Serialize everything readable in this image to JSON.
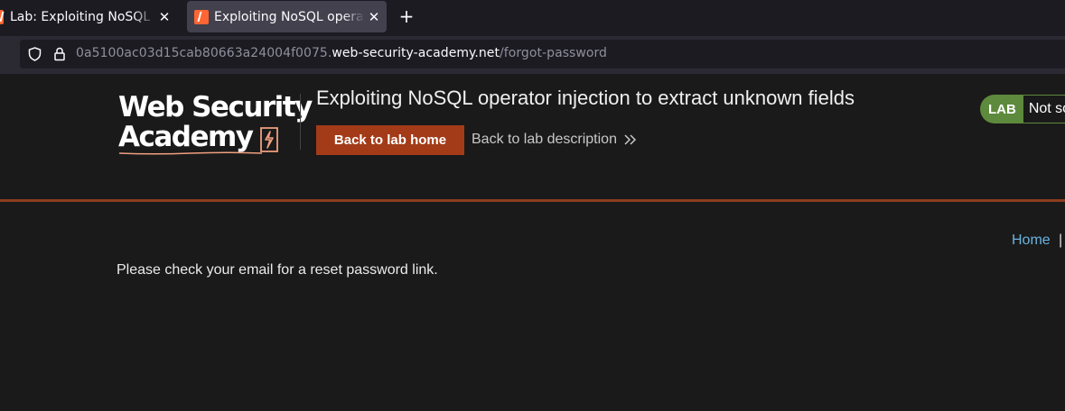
{
  "browser": {
    "tabs": [
      {
        "title": "Lab: Exploiting NoSQL op",
        "active": false
      },
      {
        "title": "Exploiting NoSQL operato",
        "active": true
      }
    ],
    "new_tab_glyph": "+",
    "close_glyph": "✕",
    "url": {
      "prefix": "0a5100ac03d15cab80663a24004f0075.",
      "domain": "web-security-academy.net",
      "path": "/forgot-password"
    }
  },
  "header": {
    "logo": {
      "line1": "Web Security",
      "line2": "Academy"
    },
    "lab_title": "Exploiting NoSQL operator injection to extract unknown fields",
    "back_to_lab_home": "Back to lab home",
    "back_to_lab_description": "Back to lab description",
    "status_badge": "LAB",
    "status_text": "Not solved"
  },
  "nav": {
    "home": "Home",
    "separator": "|"
  },
  "main": {
    "message": "Please check your email for a reset password link."
  },
  "colors": {
    "accent": "#a33b18",
    "status_green": "#5d8a3c",
    "link_blue": "#6bb3e0",
    "header_border": "#8c3d1e"
  },
  "icons": [
    "portswigger-favicon-icon",
    "close-icon",
    "plus-icon",
    "shield-icon",
    "lock-icon",
    "lightning-bolt-icon",
    "double-chevron-right-icon"
  ]
}
